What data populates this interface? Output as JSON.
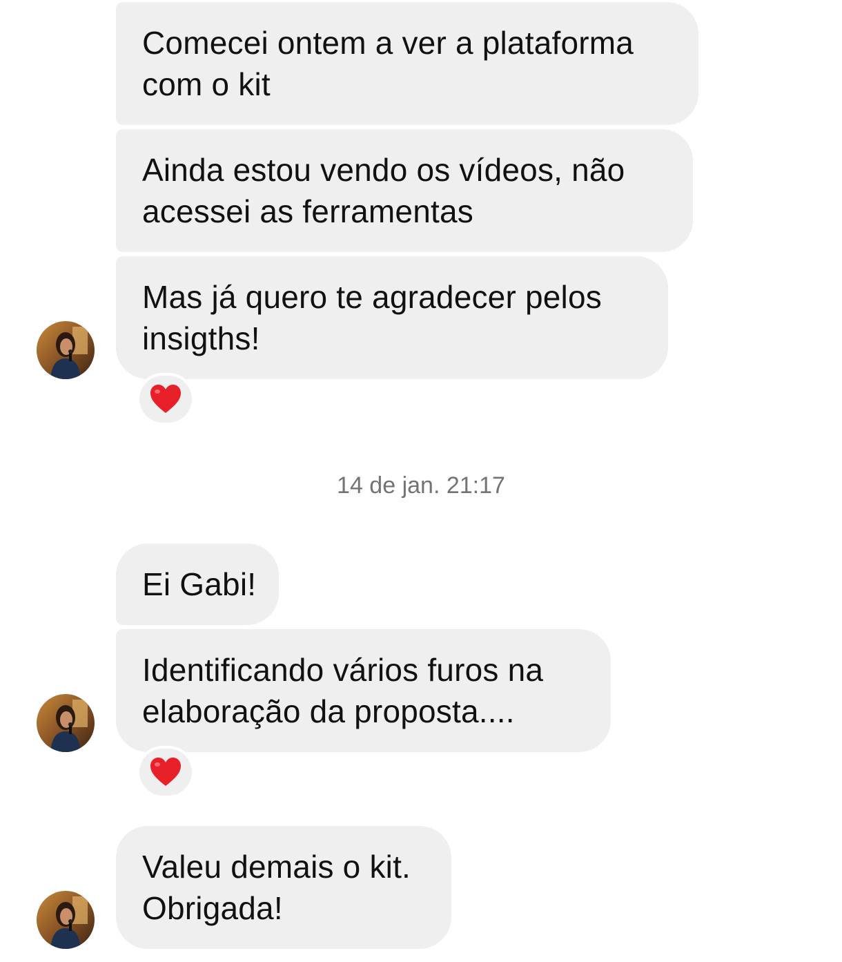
{
  "messages": [
    {
      "lines": [
        "Comecei ontem a ver a plataforma",
        "com o kit"
      ]
    },
    {
      "lines": [
        "Ainda estou vendo os vídeos, não",
        "acessei as ferramentas"
      ]
    },
    {
      "lines": [
        "Mas já quero te agradecer pelos",
        "insigths!"
      ],
      "reaction": "heart-emoji"
    },
    {
      "lines": [
        "Ei Gabi!"
      ]
    },
    {
      "lines": [
        "Identificando vários furos na",
        "elaboração da proposta...."
      ],
      "reaction": "heart-emoji"
    },
    {
      "lines": [
        "Valeu demais o kit.",
        "Obrigada!"
      ]
    }
  ],
  "timestamp": "14 de jan. 21:17",
  "colors": {
    "bubble_bg": "#efefef",
    "timestamp_text": "#737373",
    "heart": "#e8202a"
  },
  "icons": {
    "avatar": "profile-photo-avatar",
    "reaction": "red-heart-icon"
  }
}
